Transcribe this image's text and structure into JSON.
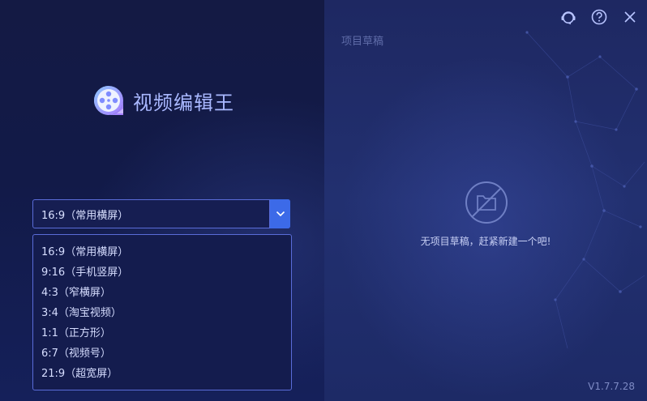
{
  "app": {
    "title": "视频编辑王",
    "version": "V1.7.7.28"
  },
  "aspect_select": {
    "selected": "16:9（常用横屏）",
    "options": [
      "16:9（常用横屏）",
      "9:16（手机竖屏）",
      "4:3（窄横屏）",
      "3:4（淘宝视频）",
      "1:1（正方形）",
      "6:7（视频号）",
      "21:9（超宽屏）"
    ]
  },
  "drafts": {
    "title": "项目草稿",
    "empty_message": "无项目草稿，赶紧新建一个吧!"
  },
  "icons": {
    "support": "headset-icon",
    "help": "help-icon",
    "close": "close-icon",
    "empty": "empty-folder-icon",
    "dropdown": "chevron-down-icon"
  },
  "colors": {
    "accent": "#3c6ae8",
    "left_bg": "#141a44",
    "right_bg": "#223070",
    "text": "#d6ddff"
  }
}
